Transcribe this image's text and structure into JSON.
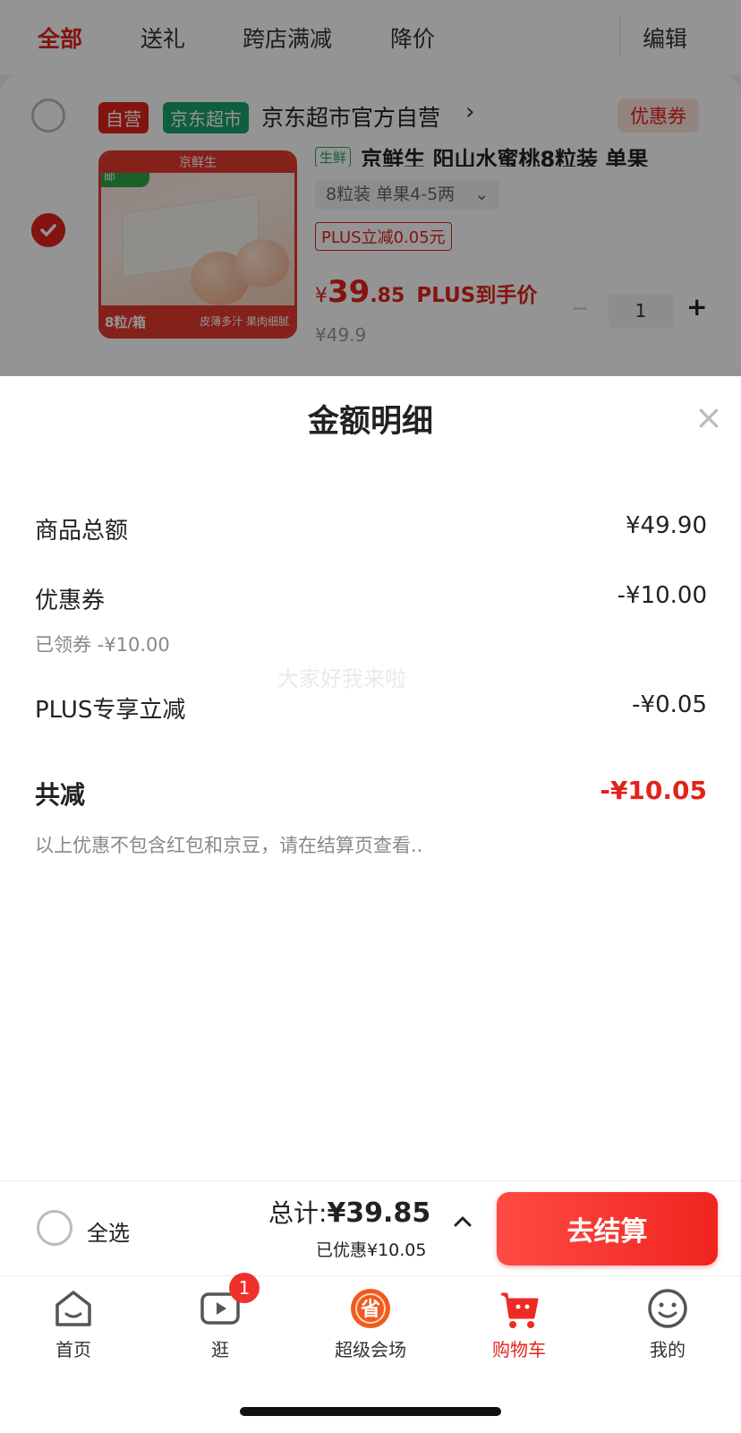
{
  "tabs": {
    "items": [
      "全部",
      "送礼",
      "跨店满减",
      "降价"
    ],
    "edit": "编辑"
  },
  "store": {
    "tag_self": "自营",
    "tag_market": "京东超市",
    "name": "京东超市官方自营",
    "arrow": "›",
    "coupon": "优惠券"
  },
  "product": {
    "fresh_tag": "生鲜",
    "title": "京鲜生 阳山水蜜桃8粒装 单果",
    "spec": "8粒装 单果4-5两",
    "plus_tag": "PLUS立减0.05元",
    "price_symbol": "¥",
    "price_int": "39",
    "price_dec": ".85",
    "price_suffix": "PLUS到手价",
    "orig_price": "¥49.9",
    "qty": "1",
    "qty_minus": "−",
    "qty_plus": "+",
    "thumb_badge": "一件包邮",
    "thumb_brand": "京鲜生",
    "thumb_count": "8粒/箱",
    "thumb_slogan": "皮薄多汁 果肉细腻"
  },
  "sheet": {
    "title": "金额明细",
    "close": "×",
    "rows": [
      {
        "label": "商品总额",
        "value": "¥49.90"
      },
      {
        "label": "优惠券",
        "value": "-¥10.00",
        "sub": "已领券 -¥10.00"
      },
      {
        "label": "PLUS专享立减",
        "value": "-¥0.05"
      }
    ],
    "total_label": "共减",
    "total_value": "-¥10.05",
    "note": "以上优惠不包含红包和京豆，请在结算页查看..",
    "watermark": "大家好我来啦"
  },
  "bottom": {
    "select_all": "全选",
    "total_prefix": "总计:",
    "total": "¥39.85",
    "saved": "已优惠¥10.05",
    "checkout": "去结算"
  },
  "nav": {
    "items": [
      {
        "label": "首页",
        "icon": "home-icon"
      },
      {
        "label": "逛",
        "icon": "video-icon",
        "badge": "1"
      },
      {
        "label": "超级会场",
        "icon": "super-venue-icon"
      },
      {
        "label": "购物车",
        "icon": "cart-icon",
        "active": true
      },
      {
        "label": "我的",
        "icon": "profile-icon"
      }
    ]
  },
  "colors": {
    "accent": "#e2231a",
    "market_green": "#1aa26a"
  }
}
